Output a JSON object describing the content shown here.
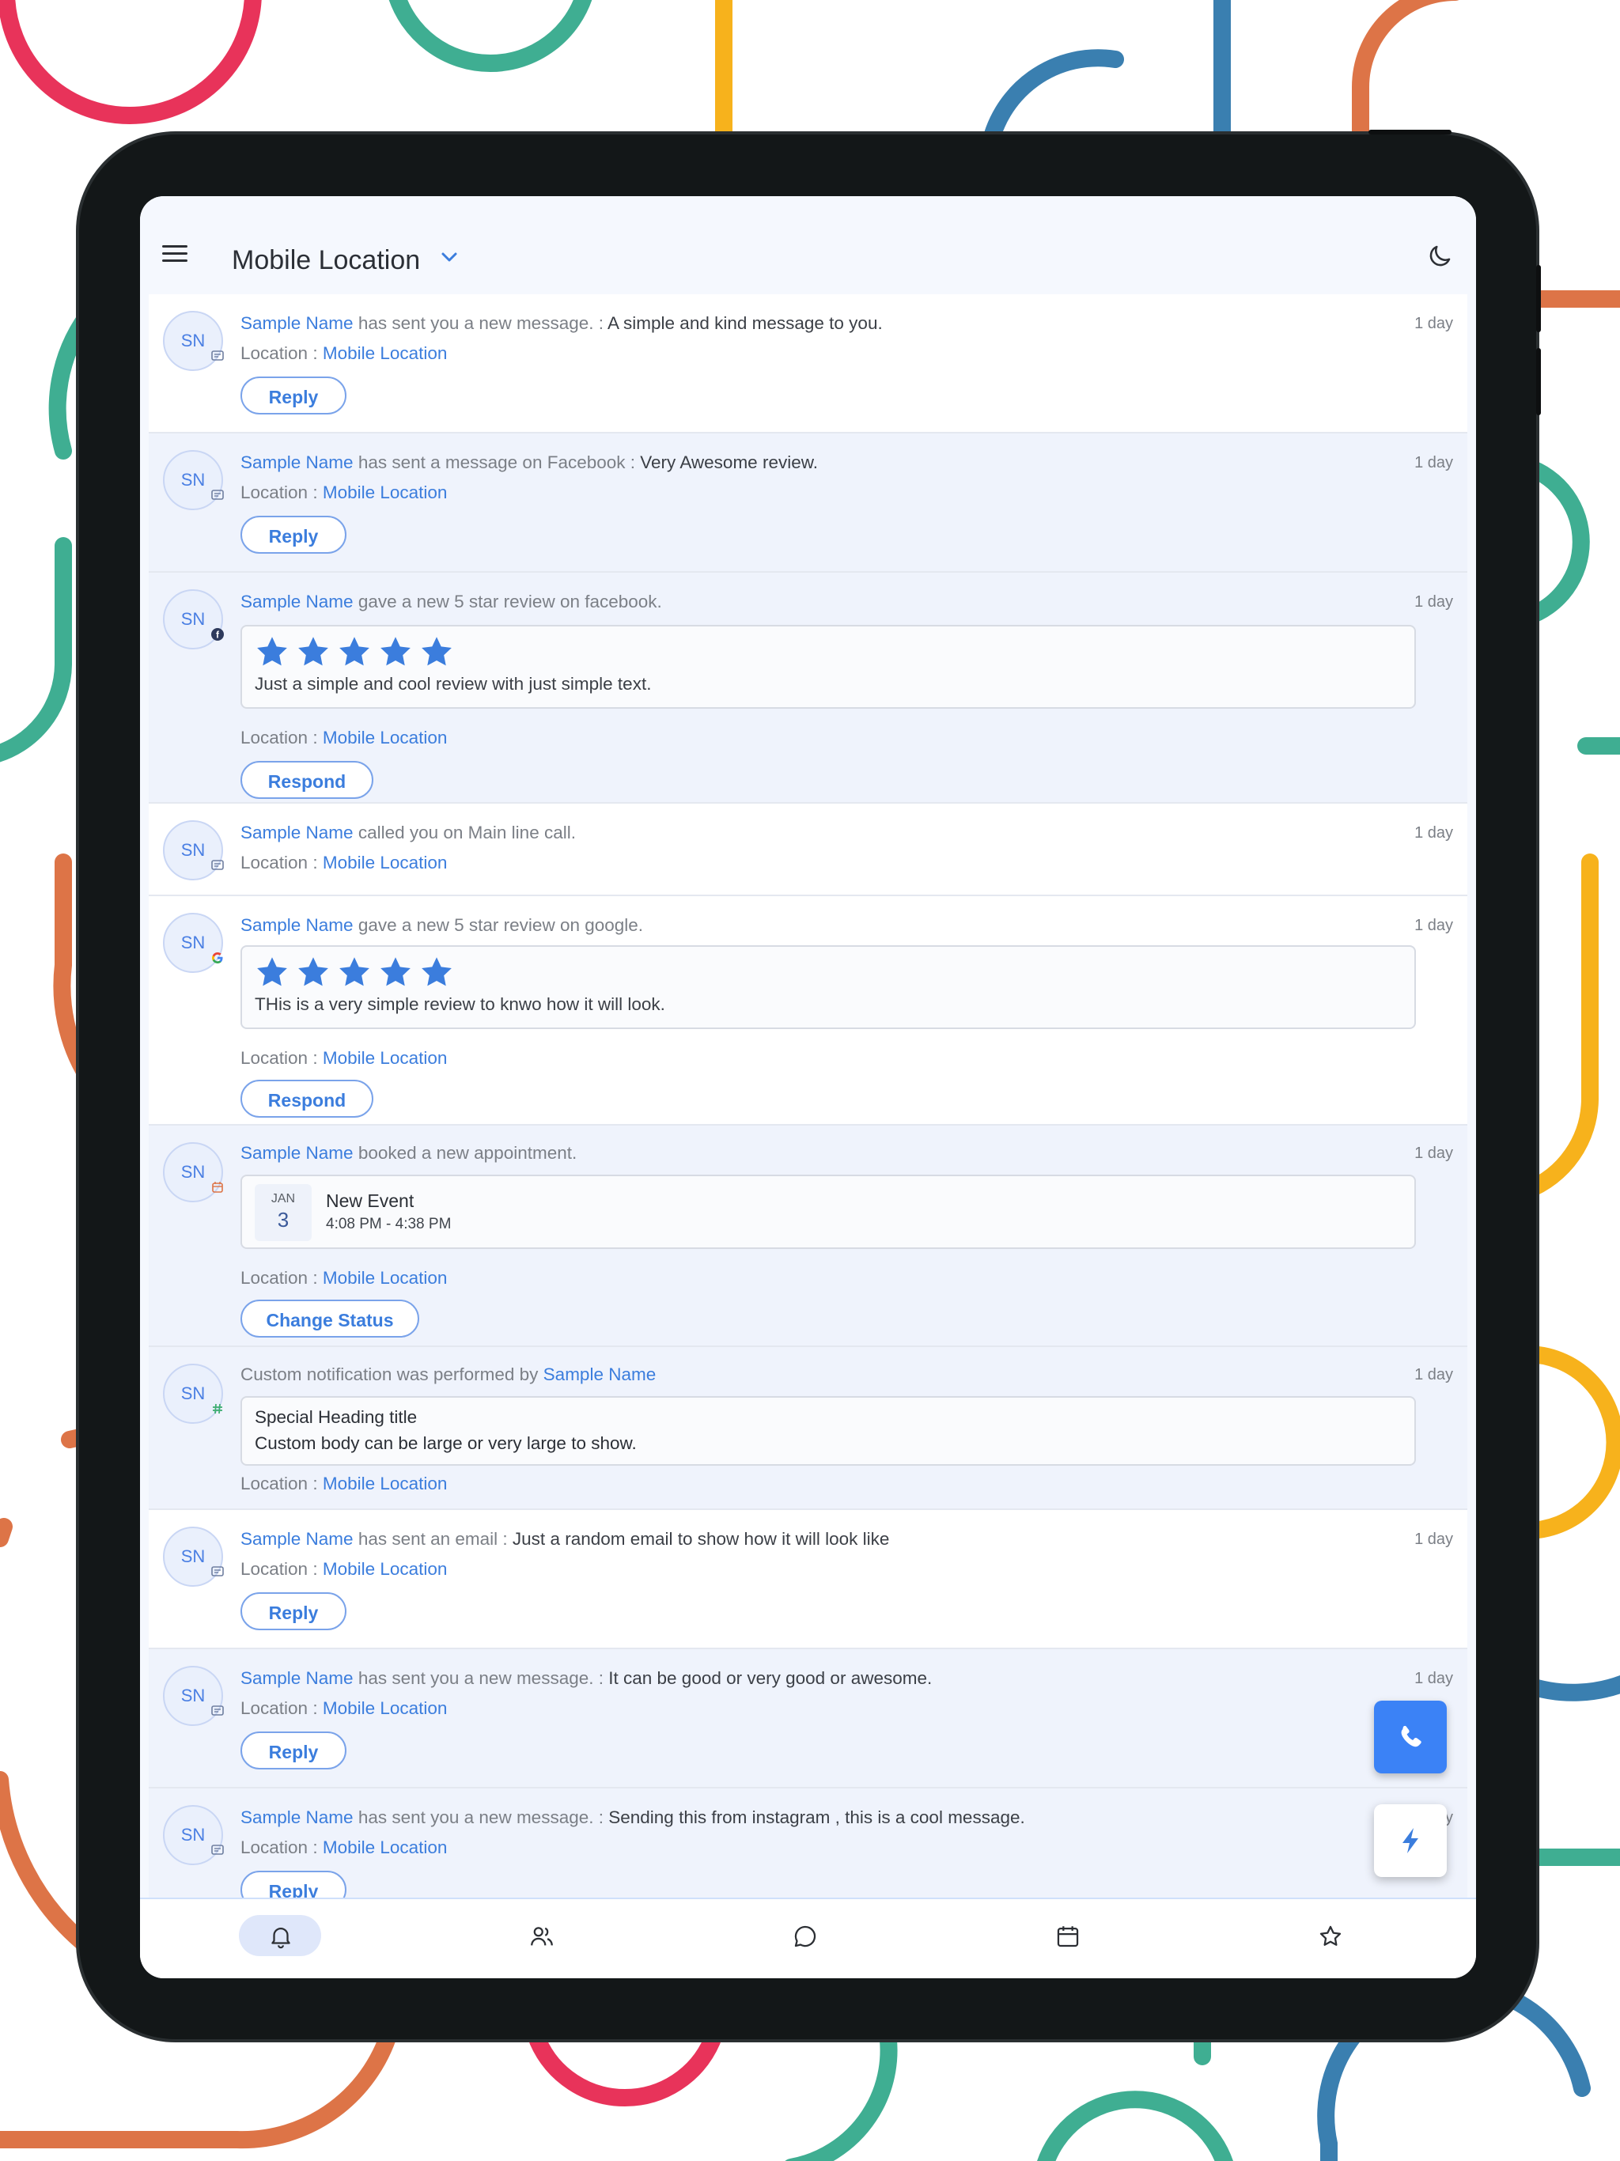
{
  "app": {
    "location_title": "Mobile Location"
  },
  "common": {
    "location_label": "Location : ",
    "location_value": "Mobile Location",
    "avatar_initials": "SN"
  },
  "feed": [
    {
      "name": "Sample Name",
      "action": " has sent you a new message. : ",
      "message": "A simple and kind message to you.",
      "time": "1 day",
      "button": "Reply",
      "source_icon": "message-icon"
    },
    {
      "name": "Sample Name",
      "action": " has sent a message on Facebook : ",
      "message": "Very Awesome review.",
      "time": "1 day",
      "button": "Reply",
      "source_icon": "message-icon"
    },
    {
      "name": "Sample Name",
      "action": " gave a new 5 star review on facebook.",
      "time": "1 day",
      "rating": 5,
      "review": "Just a simple and cool review with just simple text.",
      "button": "Respond",
      "source_icon": "facebook-icon"
    },
    {
      "name": "Sample Name",
      "action": " called you on Main line call.",
      "time": "1 day",
      "source_icon": "message-icon"
    },
    {
      "name": "Sample Name",
      "action": " gave a new 5 star review on google.",
      "time": "1 day",
      "rating": 5,
      "review": "THis is a very simple review to knwo how it will look.",
      "button": "Respond",
      "source_icon": "google-icon"
    },
    {
      "name": "Sample Name",
      "action": " booked a new appointment.",
      "time": "1 day",
      "event": {
        "month": "JAN",
        "day": "3",
        "title": "New Event",
        "time": "4:08 PM - 4:38 PM"
      },
      "button": "Change Status",
      "source_icon": "calendar-icon"
    },
    {
      "prefix": "Custom notification was performed by ",
      "name": "Sample Name",
      "time": "1 day",
      "custom": {
        "heading": "Special Heading title",
        "body": "Custom body can be large or very large to show."
      },
      "source_icon": "hash-icon"
    },
    {
      "name": "Sample Name",
      "action": " has sent an email : ",
      "message": "Just a random email to show how it will look like",
      "time": "1 day",
      "button": "Reply",
      "source_icon": "message-icon"
    },
    {
      "name": "Sample Name",
      "action": " has sent you a new message. : ",
      "message": "It can be good or very good or awesome.",
      "time": "1 day",
      "button": "Reply",
      "source_icon": "message-icon"
    },
    {
      "name": "Sample Name",
      "action": " has sent you a new message. : ",
      "message": "Sending this from instagram , this is a cool message.",
      "time": "1 day",
      "button": "Reply",
      "source_icon": "message-icon"
    }
  ],
  "bottom_nav": [
    {
      "icon": "bell-icon",
      "active": true
    },
    {
      "icon": "users-icon",
      "active": false
    },
    {
      "icon": "chat-icon",
      "active": false
    },
    {
      "icon": "calendar-icon",
      "active": false
    },
    {
      "icon": "star-icon",
      "active": false
    }
  ],
  "colors": {
    "accent": "#3b7ddd",
    "fab_call": "#3b82f6",
    "star": "#3b7ddd"
  }
}
